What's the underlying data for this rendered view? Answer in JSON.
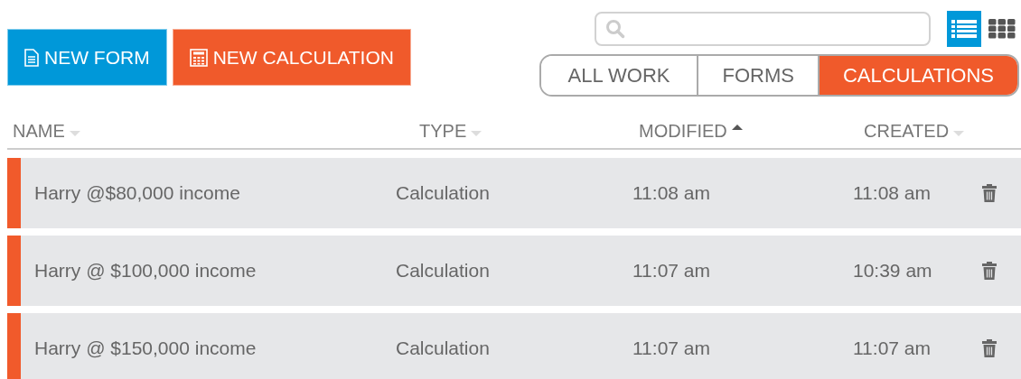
{
  "buttons": [
    {
      "label": "NEW FORM",
      "kind": "form"
    },
    {
      "label": "NEW CALCULATION",
      "kind": "calculation"
    }
  ],
  "view_toggle": [
    {
      "kind": "list",
      "selected": true
    },
    {
      "kind": "grid",
      "selected": false
    }
  ],
  "tabs": [
    {
      "label": "ALL WORK",
      "selected": false
    },
    {
      "label": "FORMS",
      "selected": false
    },
    {
      "label": "CALCULATIONS",
      "selected": true
    }
  ],
  "table": {
    "columns": [
      {
        "label": "NAME",
        "sorted": false
      },
      {
        "label": "TYPE",
        "sorted": false
      },
      {
        "label": "MODIFIED",
        "sorted": true
      },
      {
        "label": "CREATED",
        "sorted": false
      }
    ],
    "rows": [
      {
        "name": "Harry @$80,000 income",
        "type": "Calculation",
        "modified": "11:08 am",
        "created": "11:08 am",
        "color": "#f15a2b"
      },
      {
        "name": "Harry @ $100,000 income",
        "type": "Calculation",
        "modified": "11:07 am",
        "created": "10:39 am",
        "color": "#f15a2b"
      },
      {
        "name": "Harry @ $150,000 income",
        "type": "Calculation",
        "modified": "11:07 am",
        "created": "11:07 am",
        "color": "#f15a2b"
      }
    ]
  }
}
